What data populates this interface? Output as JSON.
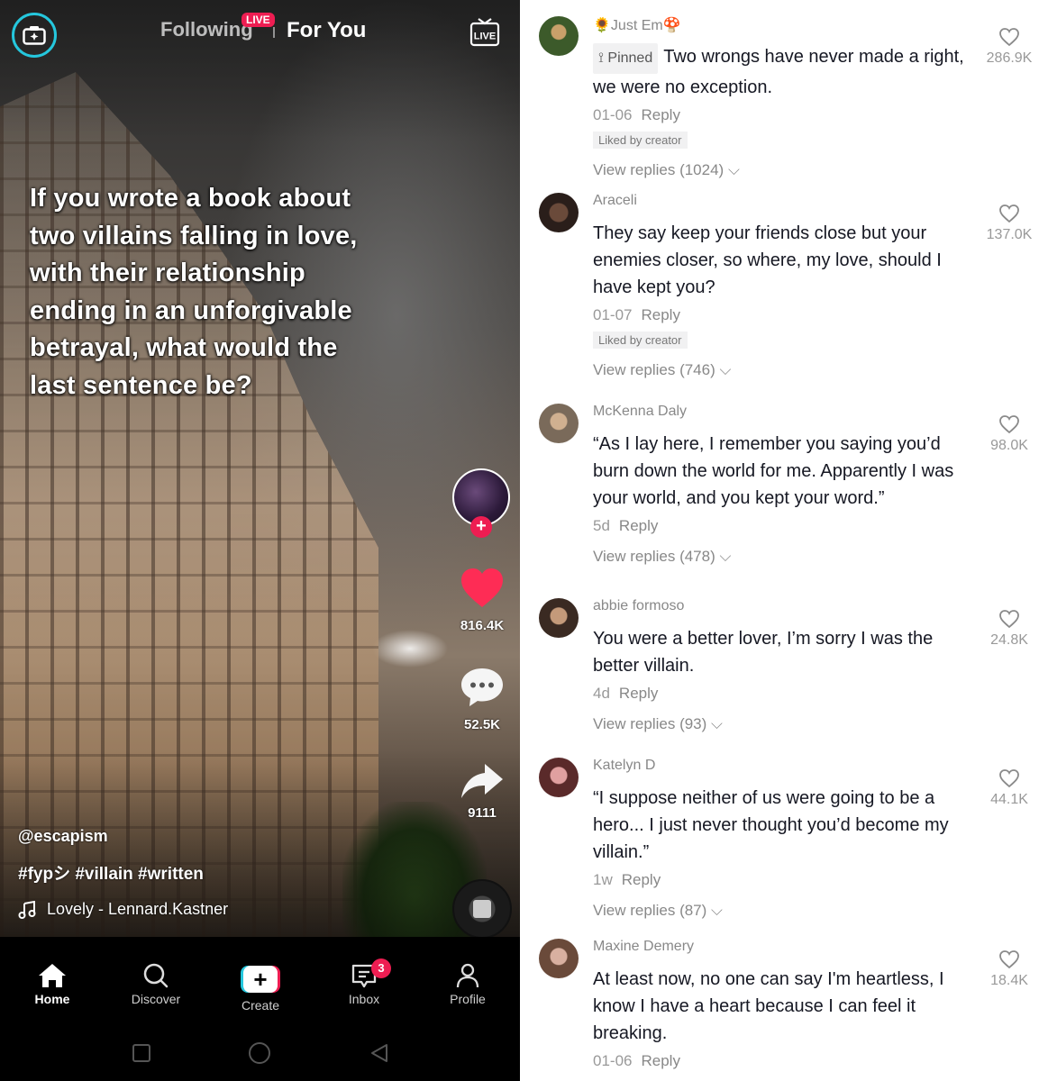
{
  "top": {
    "following": "Following",
    "live_badge": "LIVE",
    "for_you": "For You",
    "live_label": "LIVE"
  },
  "video": {
    "caption": "If you wrote a book about two villains falling in love, with their relationship ending in an unforgivable betrayal, what would the last sentence be?",
    "username": "@escapism",
    "hashtags": "#fypシ #villain #written",
    "sound": "Lovely - Lennard.Kastner",
    "likes": "816.4K",
    "comments": "52.5K",
    "shares": "9111",
    "follow_plus": "+"
  },
  "nav": {
    "home": "Home",
    "discover": "Discover",
    "create": "Create",
    "inbox": "Inbox",
    "inbox_badge": "3",
    "profile": "Profile"
  },
  "comments": [
    {
      "user": "🌻Just Em🍄",
      "pinned": "Pinned",
      "text": "Two wrongs have never made a right, we were no exception.",
      "date": "01-06",
      "reply": "Reply",
      "liked_by_creator": "Liked by creator",
      "replies": "View replies (1024)",
      "likes": "286.9K"
    },
    {
      "user": "Araceli",
      "text": "They say keep your friends close but your enemies closer, so where, my love, should I have kept you?",
      "date": "01-07",
      "reply": "Reply",
      "liked_by_creator": "Liked by creator",
      "replies": "View replies (746)",
      "likes": "137.0K"
    },
    {
      "user": "McKenna Daly",
      "text": "“As I lay here, I remember you saying you’d burn down the world for me. Apparently I was your world, and you kept your word.”",
      "date": "5d",
      "reply": "Reply",
      "replies": "View replies (478)",
      "likes": "98.0K"
    },
    {
      "user": "abbie formoso",
      "text": "You were a better lover, I’m sorry I was the better villain.",
      "date": "4d",
      "reply": "Reply",
      "replies": "View replies (93)",
      "likes": "24.8K"
    },
    {
      "user": "Katelyn D",
      "text": "“I suppose neither of us were going to be a hero... I just never thought you’d become my villain.”",
      "date": "1w",
      "reply": "Reply",
      "replies": "View replies (87)",
      "likes": "44.1K"
    },
    {
      "user": "Maxine Demery",
      "text": "At least now, no one can say I'm heartless, I know I have a heart because I can feel it breaking.",
      "date": "01-06",
      "reply": "Reply",
      "likes": "18.4K"
    }
  ],
  "colors": {
    "accent": "#ee1d52",
    "cyan": "#25c7dd",
    "like_red": "#fe2c55"
  }
}
